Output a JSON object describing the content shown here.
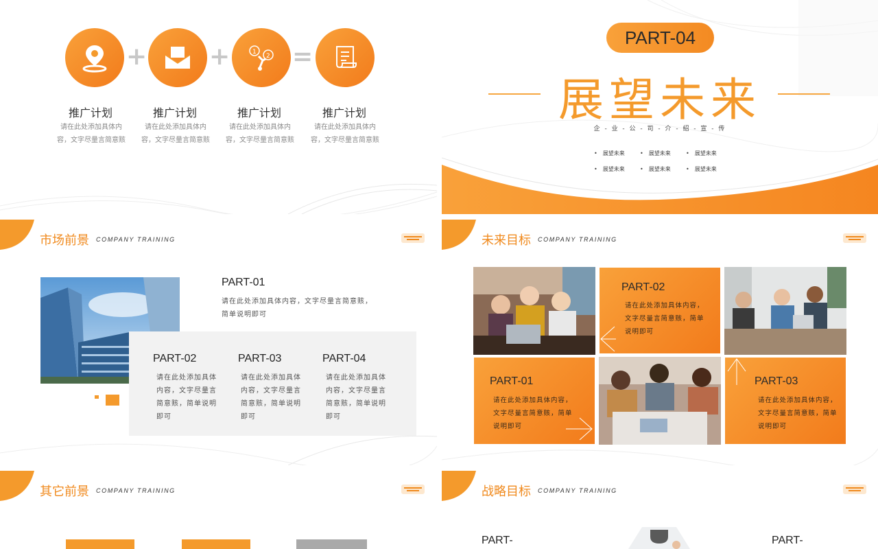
{
  "slide1": {
    "items": [
      {
        "icon": "location-pin-icon",
        "title": "推广计划",
        "desc": "请在此处添加具体内容，文字尽量言简意赅"
      },
      {
        "icon": "envelope-icon",
        "title": "推广计划",
        "desc": "请在此处添加具体内容，文字尽量言简意赅"
      },
      {
        "icon": "connection-nodes-icon",
        "title": "推广计划",
        "desc": "请在此处添加具体内容，文字尽量言简意赅"
      },
      {
        "icon": "scroll-icon",
        "title": "推广计划",
        "desc": "请在此处添加具体内容，文字尽量言简意赅"
      }
    ],
    "operators": [
      "+",
      "+",
      "="
    ]
  },
  "slide2": {
    "part": "PART-04",
    "title": "展望未来",
    "subtitle": "企 - 业 - 公 - 司 - 介 - 绍 - 宣 - 传",
    "bullets": [
      "展望未来",
      "展望未来",
      "展望未来",
      "展望未来",
      "展望未来",
      "展望未来"
    ]
  },
  "slide3": {
    "title": "市场前景",
    "subtitle": "COMPANY TRAINING",
    "part1": {
      "label": "PART-01",
      "desc_l1": "请在此处添加具体内容，文字尽量言简意赅，",
      "desc_l2": "简单说明即可"
    },
    "parts": [
      {
        "label": "PART-02",
        "l1": "请在此处添加具体",
        "l2": "内容，文字尽量言",
        "l3": "简意赅，简单说明",
        "l4": "即可"
      },
      {
        "label": "PART-03",
        "l1": "请在此处添加具体",
        "l2": "内容，文字尽量言",
        "l3": "简意赅，简单说明",
        "l4": "即可"
      },
      {
        "label": "PART-04",
        "l1": "请在此处添加具体",
        "l2": "内容，文字尽量言",
        "l3": "简意赅，简单说明",
        "l4": "即可"
      }
    ]
  },
  "slide4": {
    "title": "未来目标",
    "subtitle": "COMPANY TRAINING",
    "boxes": [
      {
        "label": "PART-02",
        "l1": "请在此处添加具体内容，",
        "l2": "文字尽量言简意赅，简单",
        "l3": "说明即可"
      },
      {
        "label": "PART-01",
        "l1": "请在此处添加具体内容，",
        "l2": "文字尽量言简意赅，简单",
        "l3": "说明即可"
      },
      {
        "label": "PART-03",
        "l1": "请在此处添加具体内容，",
        "l2": "文字尽量言简意赅，简单",
        "l3": "说明即可"
      }
    ]
  },
  "slide5": {
    "title": "其它前景",
    "subtitle": "COMPANY TRAINING"
  },
  "slide6": {
    "title": "战略目标",
    "subtitle": "COMPANY TRAINING",
    "part_left": "PART-",
    "part_right": "PART-"
  },
  "colors": {
    "accent": "#f49a2c",
    "accent_dark": "#f27b1b",
    "grey_box": "#f2f2f2"
  }
}
